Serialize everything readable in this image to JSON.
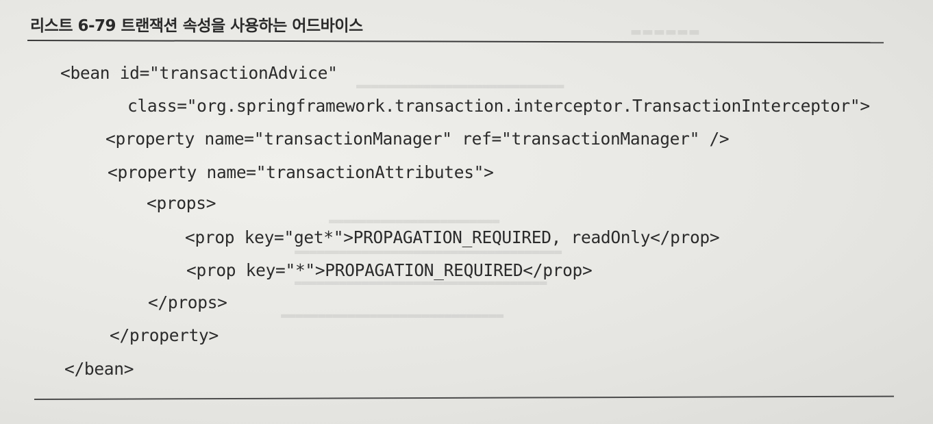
{
  "listing": {
    "title": "리스트 6-79 트랜잭션 속성을 사용하는 어드바이스"
  },
  "code": {
    "lines": [
      "<bean id=\"transactionAdvice\"",
      "class=\"org.springframework.transaction.interceptor.TransactionInterceptor\">",
      "<property name=\"transactionManager\" ref=\"transactionManager\" />",
      "<property name=\"transactionAttributes\">",
      "<props>",
      "<prop key=\"get*\">PROPAGATION_REQUIRED, readOnly</prop>",
      "<prop key=\"*\">PROPAGATION_REQUIRED</prop>",
      "</props>",
      "</property>",
      "</bean>"
    ]
  }
}
